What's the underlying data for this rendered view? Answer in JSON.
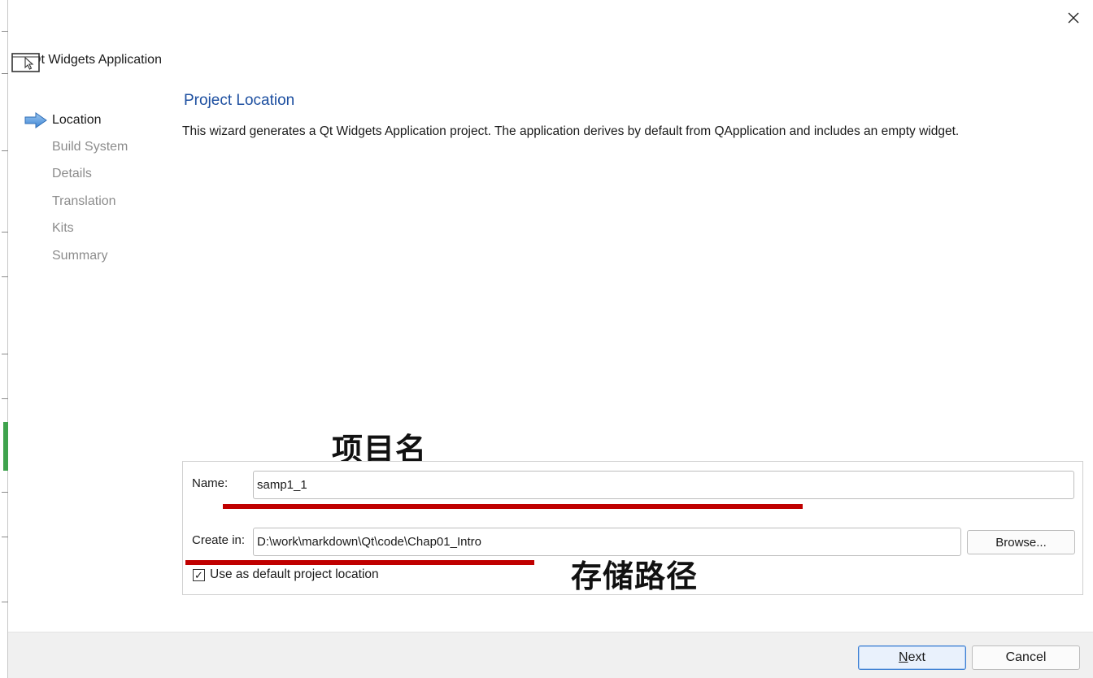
{
  "window": {
    "app_title": "Qt Widgets Application",
    "close_icon": "close-icon"
  },
  "steps": [
    {
      "label": "Location",
      "active": true
    },
    {
      "label": "Build System",
      "active": false
    },
    {
      "label": "Details",
      "active": false
    },
    {
      "label": "Translation",
      "active": false
    },
    {
      "label": "Kits",
      "active": false
    },
    {
      "label": "Summary",
      "active": false
    }
  ],
  "page": {
    "title": "Project Location",
    "description": "This wizard generates a Qt Widgets Application project. The application derives by default from QApplication and includes an empty widget."
  },
  "annotations": {
    "project_name_note": "项目名",
    "storage_path_note": "存储路径"
  },
  "form": {
    "name_label": "Name:",
    "name_value": "samp1_1",
    "create_in_label": "Create in:",
    "create_in_value": "D:\\work\\markdown\\Qt\\code\\Chap01_Intro",
    "browse_label": "Browse...",
    "default_location_checked": true,
    "default_location_label": "Use as default project location"
  },
  "footer": {
    "next_mnemonic": "N",
    "next_rest": "ext",
    "cancel_label": "Cancel"
  },
  "colors": {
    "title_blue": "#1d4fa0",
    "annotation_red": "#c00000",
    "accent_green": "#3fa34d",
    "default_button_border": "#3b7fd4"
  }
}
